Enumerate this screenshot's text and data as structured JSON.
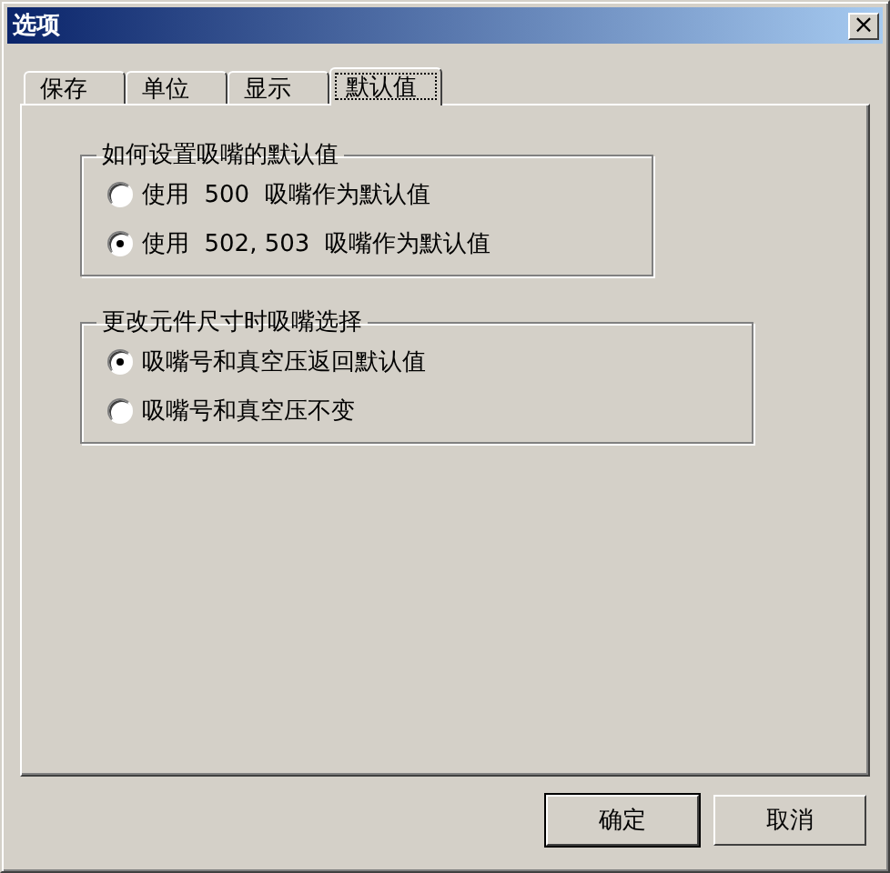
{
  "window": {
    "title": "选项",
    "close": "×"
  },
  "tabs": [
    {
      "label": "保存",
      "selected": false
    },
    {
      "label": "单位",
      "selected": false
    },
    {
      "label": "显示",
      "selected": false
    },
    {
      "label": "默认值",
      "selected": true
    }
  ],
  "groups": [
    {
      "title": "如何设置吸嘴的默认值",
      "options": [
        {
          "label": "使用  500  吸嘴作为默认值",
          "selected": false
        },
        {
          "label": "使用  502, 503  吸嘴作为默认值",
          "selected": true
        }
      ]
    },
    {
      "title": "更改元件尺寸时吸嘴选择",
      "options": [
        {
          "label": "吸嘴号和真空压返回默认值",
          "selected": true
        },
        {
          "label": "吸嘴号和真空压不变",
          "selected": false
        }
      ]
    }
  ],
  "buttons": [
    {
      "label": "确定",
      "default": true
    },
    {
      "label": "取消",
      "default": false
    }
  ]
}
